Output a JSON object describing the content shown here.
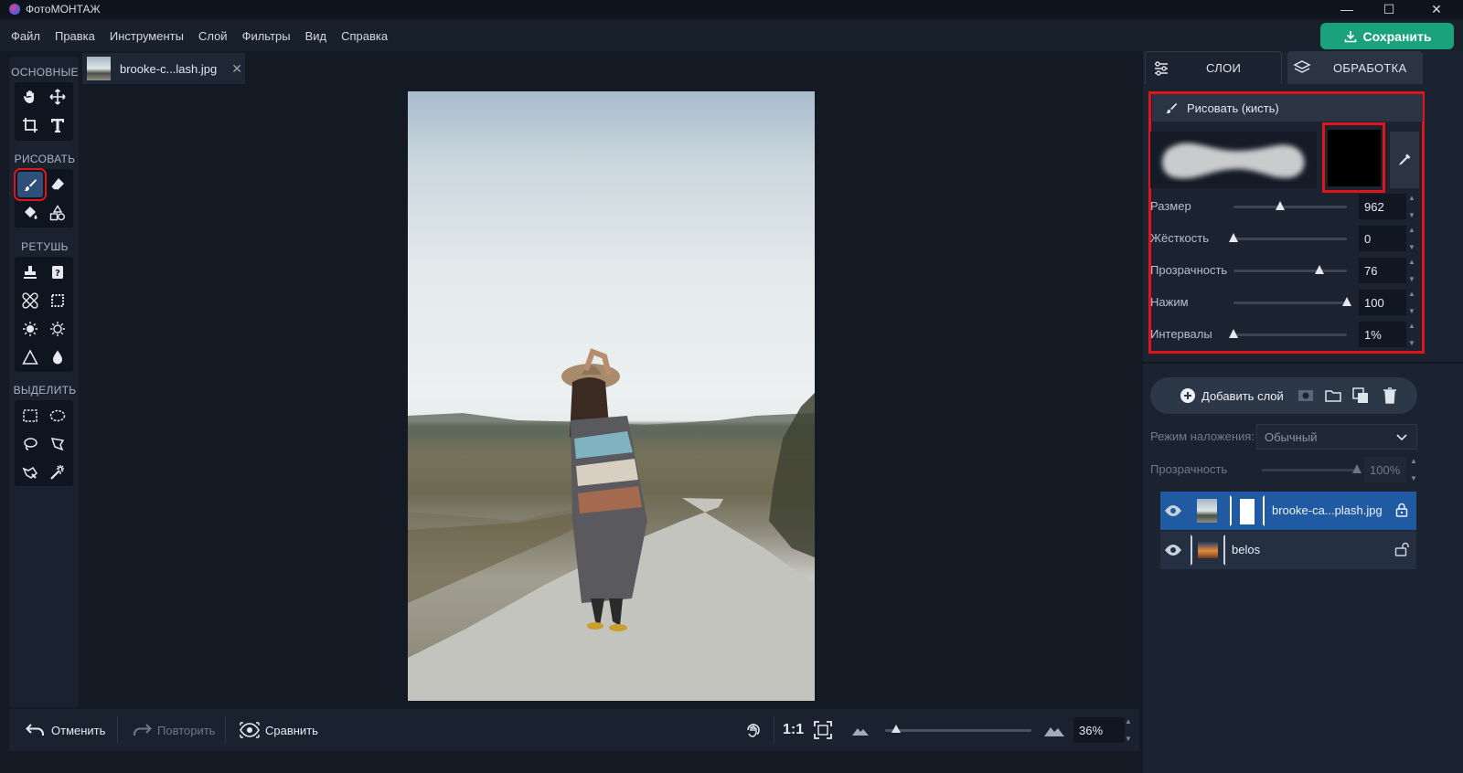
{
  "window": {
    "title": "ФотоМОНТАЖ",
    "minimize": "—",
    "maximize": "☐",
    "close": "✕"
  },
  "menu": {
    "items": [
      "Файл",
      "Правка",
      "Инструменты",
      "Слой",
      "Фильтры",
      "Вид",
      "Справка"
    ],
    "save_label": "Сохранить"
  },
  "tools": {
    "sections": [
      "ОСНОВНЫЕ",
      "РИСОВАТЬ",
      "РЕТУШЬ",
      "ВЫДЕЛИТЬ"
    ],
    "active_tool": "brush-tool"
  },
  "document": {
    "tab_name": "brooke-c...lash.jpg",
    "tab_close": "✕"
  },
  "bottom": {
    "undo_label": "Отменить",
    "redo_label": "Повторить",
    "compare_label": "Сравнить",
    "one_to_one": "1:1",
    "zoom_value": "36%",
    "zoom_fraction": 0.02
  },
  "panel": {
    "tab_layers": "СЛОИ",
    "tab_processing": "ОБРАБОТКА",
    "brush_title": "Рисовать (кисть)",
    "brush_color": "#000000",
    "params": [
      {
        "label": "Размер",
        "value": "962",
        "level": 0.41
      },
      {
        "label": "Жёсткость",
        "value": "0",
        "level": 0.0
      },
      {
        "label": "Прозрачность",
        "value": "76",
        "level": 0.76
      },
      {
        "label": "Нажим",
        "value": "100",
        "level": 1.0
      },
      {
        "label": "Интервалы",
        "value": "1%",
        "level": 0.0
      }
    ],
    "add_layer_label": "Добавить слой",
    "blend_label": "Режим наложения:",
    "blend_value": "Обычный",
    "opacity_label": "Прозрачность",
    "opacity_value": "100%",
    "layers": [
      {
        "name": "brooke-ca...plash.jpg",
        "selected": true,
        "locked": true
      },
      {
        "name": "belos",
        "selected": false,
        "locked": false
      }
    ]
  },
  "colors": {
    "accent_green": "#1aa37a",
    "highlight_red": "#e0141b",
    "selected_layer": "#1f5aa3"
  }
}
